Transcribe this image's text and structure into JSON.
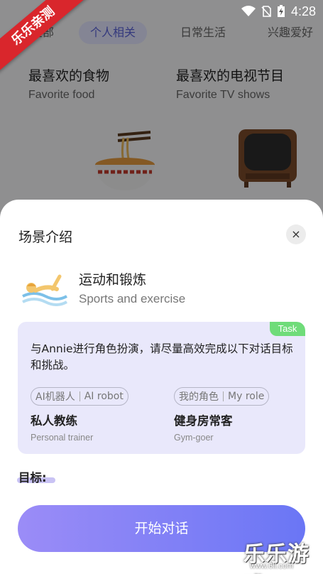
{
  "status_bar": {
    "time": "4:28"
  },
  "tabs": [
    "全部",
    "个人相关",
    "日常生活",
    "兴趣爱好"
  ],
  "cards": [
    {
      "zh": "最喜欢的食物",
      "en": "Favorite food",
      "icon": "noodle-bowl-icon"
    },
    {
      "zh": "最喜欢的电视节目",
      "en": "Favorite TV shows",
      "icon": "tv-icon"
    }
  ],
  "ribbon": "乐乐亲测",
  "sheet": {
    "title": "场景介绍",
    "close_icon": "×",
    "scene": {
      "zh": "运动和锻炼",
      "en": "Sports and exercise",
      "icon": "swimmer-icon"
    },
    "task": {
      "badge": "Task",
      "description": "与Annie进行角色扮演，请尽量高效完成以下对话目标和挑战。",
      "roles": [
        {
          "tag_zh": "AI机器人",
          "tag_en": "AI robot",
          "name_zh": "私人教练",
          "name_en": "Personal trainer"
        },
        {
          "tag_zh": "我的角色",
          "tag_en": "My role",
          "name_zh": "健身房常客",
          "name_en": "Gym-goer"
        }
      ]
    },
    "goal_label": "目标:",
    "start_button": "开始对话"
  },
  "watermark": {
    "text": "乐乐游戏",
    "url": "www.6ll.com"
  },
  "colors": {
    "accent": "#6a76f5",
    "task_bg": "#e9e8fb",
    "badge": "#6fdc79",
    "ribbon": "#d9262c"
  }
}
